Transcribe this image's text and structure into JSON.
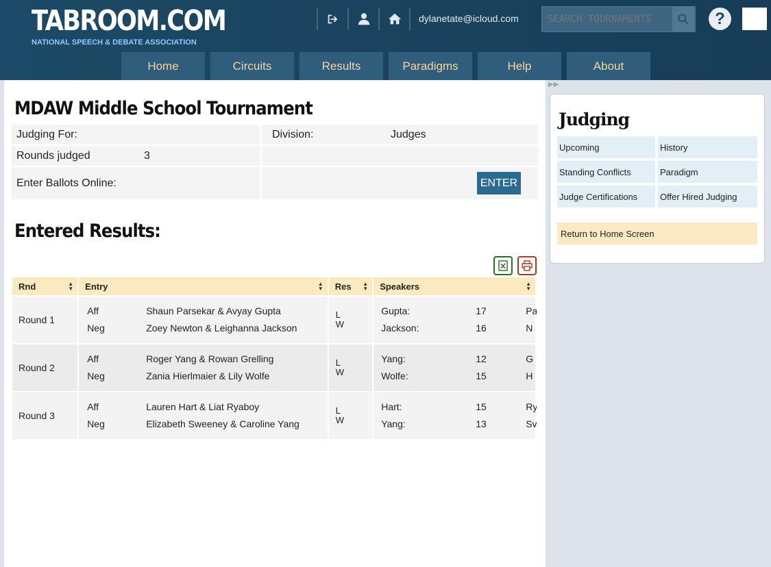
{
  "header": {
    "logo": "TABROOM.COM",
    "logo_sub": "NATIONAL SPEECH & DEBATE ASSOCIATION",
    "email": "dylanetate@icloud.com",
    "search_placeholder": "SEARCH TOURNAMENTS",
    "help_label": "?"
  },
  "nav": [
    "Home",
    "Circuits",
    "Results",
    "Paradigms",
    "Help",
    "About"
  ],
  "tournament": {
    "title": "MDAW Middle School Tournament",
    "judging_for_label": "Judging For:",
    "division_label": "Division:",
    "division_value": "Judges",
    "rounds_judged_label": "Rounds judged",
    "rounds_judged_value": "3",
    "ballots_label": "Enter Ballots Online:",
    "enter_label": "ENTER"
  },
  "results": {
    "title": "Entered Results:",
    "columns": [
      "Rnd",
      "Entry",
      "Res",
      "Speakers"
    ],
    "rows": [
      {
        "round": "Round 1",
        "side1": "Aff",
        "team1": "Shaun Parsekar & Avyay Gupta",
        "side2": "Neg",
        "team2": "Zoey Newton & Leighanna Jackson",
        "res1": "L",
        "res2": "W",
        "spk1": "Gupta:",
        "pts1": "17",
        "more1": "Pa",
        "spk2": "Jackson:",
        "pts2": "16",
        "more2": "N"
      },
      {
        "round": "Round 2",
        "side1": "Aff",
        "team1": "Roger Yang & Rowan Grelling",
        "side2": "Neg",
        "team2": "Zania Hierlmaier & Lily Wolfe",
        "res1": "L",
        "res2": "W",
        "spk1": "Yang:",
        "pts1": "12",
        "more1": "G",
        "spk2": "Wolfe:",
        "pts2": "15",
        "more2": "H"
      },
      {
        "round": "Round 3",
        "side1": "Aff",
        "team1": "Lauren Hart & Liat Ryaboy",
        "side2": "Neg",
        "team2": "Elizabeth Sweeney & Caroline Yang",
        "res1": "L",
        "res2": "W",
        "spk1": "Hart:",
        "pts1": "15",
        "more1": "Ry",
        "spk2": "Yang:",
        "pts2": "13",
        "more2": "Sv"
      }
    ]
  },
  "sidebar": {
    "title": "Judging",
    "links": [
      "Upcoming",
      "History",
      "Standing Conflicts",
      "Paradigm",
      "Judge Certifications",
      "Offer Hired Judging"
    ],
    "home_link": "Return to Home Screen"
  },
  "icons": {
    "logout": "logout-icon",
    "user": "user-icon",
    "home": "home-icon",
    "search": "search-icon",
    "excel": "excel-export-icon",
    "print": "print-icon"
  },
  "colors": {
    "header_bg": "#1a4460",
    "nav_bg": "#2f5d7b",
    "nav_text": "#f3d79c",
    "enter_btn": "#2b6a91",
    "table_header": "#fbe9bf",
    "sidebar_link": "#e3eff6",
    "home_link": "#fcebc2"
  }
}
